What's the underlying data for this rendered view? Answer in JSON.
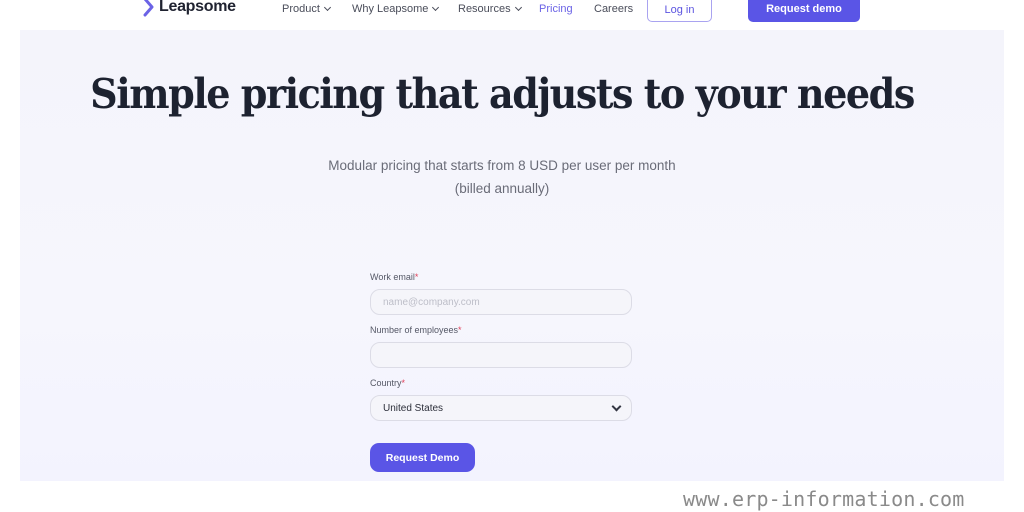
{
  "nav": {
    "brand": "Leapsome",
    "items": [
      {
        "label": "Product",
        "has_dropdown": true
      },
      {
        "label": "Why Leapsome",
        "has_dropdown": true
      },
      {
        "label": "Resources",
        "has_dropdown": true
      },
      {
        "label": "Pricing",
        "has_dropdown": false,
        "active": true
      },
      {
        "label": "Careers",
        "has_dropdown": false
      }
    ],
    "login_label": "Log in",
    "request_demo_label": "Request demo"
  },
  "hero": {
    "title": "Simple pricing that adjusts to your needs",
    "subtitle_line1": "Modular pricing that starts from 8 USD per user per month",
    "subtitle_line2": "(billed annually)"
  },
  "form": {
    "email": {
      "label": "Work email",
      "required_mark": "*",
      "placeholder": "name@company.com",
      "value": ""
    },
    "employees": {
      "label": "Number of employees",
      "required_mark": "*",
      "value": ""
    },
    "country": {
      "label": "Country",
      "required_mark": "*",
      "value": "United States"
    },
    "submit_label": "Request Demo"
  },
  "watermark": "www.erp-information.com",
  "colors": {
    "accent": "#5a55e6",
    "active_nav": "#6b63e6",
    "hero_bg": "#f4f4fb",
    "headline": "#1d2230",
    "required": "#e0405a"
  }
}
